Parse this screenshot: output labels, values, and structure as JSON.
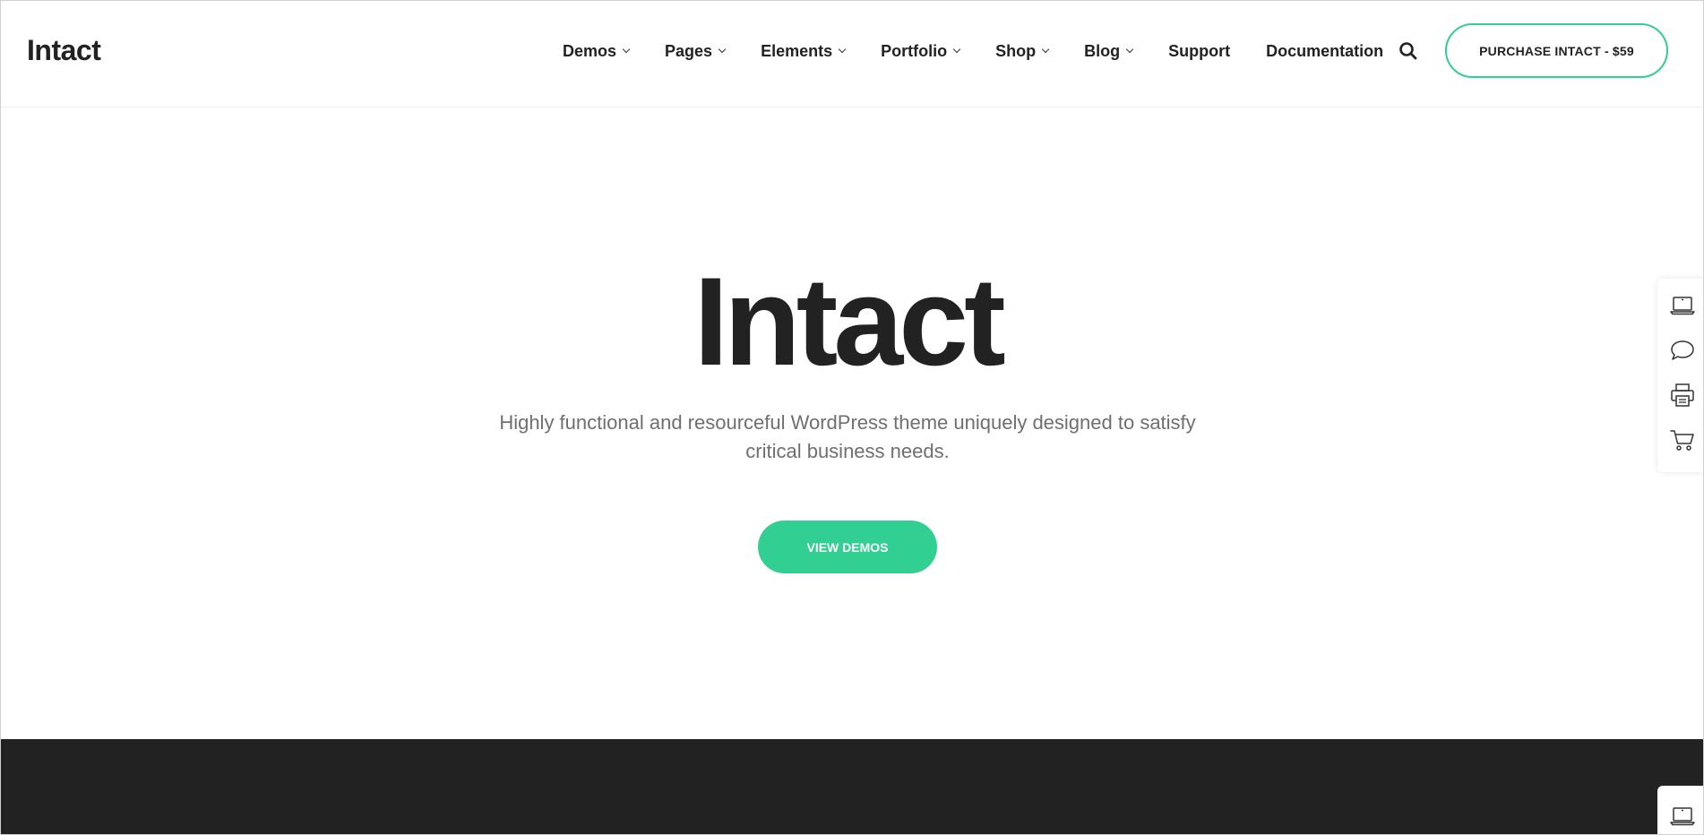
{
  "header": {
    "logo": "Intact",
    "nav": [
      {
        "label": "Demos",
        "has_dropdown": true
      },
      {
        "label": "Pages",
        "has_dropdown": true
      },
      {
        "label": "Elements",
        "has_dropdown": true
      },
      {
        "label": "Portfolio",
        "has_dropdown": true
      },
      {
        "label": "Shop",
        "has_dropdown": true
      },
      {
        "label": "Blog",
        "has_dropdown": true
      },
      {
        "label": "Support",
        "has_dropdown": false
      },
      {
        "label": "Documentation",
        "has_dropdown": false
      }
    ],
    "search_icon": "search-icon",
    "purchase_label": "PURCHASE INTACT - $59"
  },
  "hero": {
    "title": "Intact",
    "subtitle": "Highly functional and resourceful WordPress theme uniquely designed to satisfy critical business needs.",
    "cta_label": "VIEW DEMOS"
  },
  "side_panel": {
    "icons": [
      "laptop-icon",
      "chat-bubble-icon",
      "printer-icon",
      "cart-icon"
    ],
    "bottom_icon": "laptop-icon"
  },
  "colors": {
    "accent": "#31cf92",
    "text": "#222222",
    "subtext": "#6f6f6f",
    "dark_section": "#222222"
  }
}
